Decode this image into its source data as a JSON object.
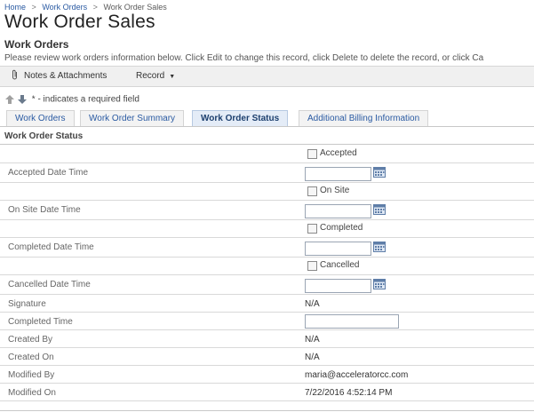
{
  "breadcrumb": {
    "home": "Home",
    "sep1": ">",
    "work_orders": "Work Orders",
    "sep2": ">",
    "current": "Work Order Sales"
  },
  "page": {
    "title": "Work Order Sales",
    "subtitle": "Work Orders",
    "description": "Please review work orders information below. Click Edit to change this record, click Delete to delete the record, or click Ca"
  },
  "toolbar": {
    "notes_label": "Notes & Attachments",
    "record_label": "Record"
  },
  "required_note": "* - indicates a required field",
  "tabs": [
    {
      "label": "Work Orders"
    },
    {
      "label": "Work Order Summary"
    },
    {
      "label": "Work Order Status"
    },
    {
      "label": "Additional Billing Information"
    }
  ],
  "section_title": "Work Order Status",
  "fields": {
    "accepted_check": "Accepted",
    "accepted_dt": "Accepted Date Time",
    "onsite_check": "On Site",
    "onsite_dt": "On Site Date Time",
    "completed_check": "Completed",
    "completed_dt": "Completed Date Time",
    "cancelled_check": "Cancelled",
    "cancelled_dt": "Cancelled Date Time",
    "signature_label": "Signature",
    "signature_value": "N/A",
    "completed_time_label": "Completed Time",
    "created_by_label": "Created By",
    "created_by_value": "N/A",
    "created_on_label": "Created On",
    "created_on_value": "N/A",
    "modified_by_label": "Modified By",
    "modified_by_value": "maria@acceleratorcc.com",
    "modified_on_label": "Modified On",
    "modified_on_value": "7/22/2016 4:52:14 PM"
  },
  "colors": {
    "link": "#2a5aa2",
    "active_tab_bg": "#e4ecf7",
    "toolbar_bg": "#f0f0f0"
  },
  "icons": [
    "paperclip-icon",
    "arrow-up-icon",
    "arrow-down-icon",
    "calendar-icon",
    "checkbox-icon"
  ]
}
